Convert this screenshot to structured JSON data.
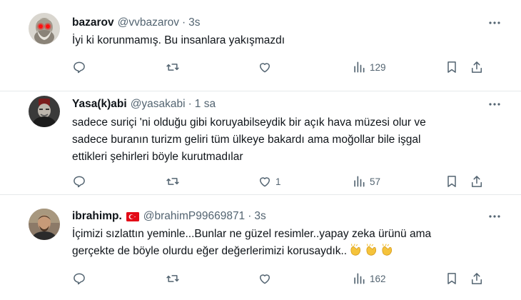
{
  "tweets": [
    {
      "name": "bazarov",
      "handle": "@vvbazarov",
      "sep": "·",
      "time": "3s",
      "lines": [
        "İyi ki korunmamış. Bu insanlara yakışmazdı"
      ],
      "replies": "",
      "retweets": "",
      "likes": "",
      "views": "129",
      "avatar_icon": "bearded-man-red-eyes-avatar"
    },
    {
      "name": "Yasa(k)abi",
      "handle": "@yasakabi",
      "sep": "·",
      "time": "1 sa",
      "lines": [
        "sadece suriçi 'ni olduğu gibi koruyabilseydik bir açık hava müzesi olur ve",
        "sadece buranın turizm geliri tüm ülkeye bakardı ama moğollar bile işgal",
        "ettikleri şehirleri böyle kurutmadılar"
      ],
      "replies": "",
      "retweets": "",
      "likes": "1",
      "views": "57",
      "avatar_icon": "dark-portrait-fez-avatar"
    },
    {
      "name": "ibrahimp.",
      "flag": "turkey-flag-icon",
      "handle": "@brahimP99669871",
      "sep": "·",
      "time": "3s",
      "lines": [
        "İçimizi sızlattın yeminle...Bunlar ne güzel resimler..yapay zeka ürünü ama",
        "gerçekte de böyle olurdu eğer değerlerimizi korusaydık.."
      ],
      "emoji": "clapping-hands",
      "emoji_count": 3,
      "replies": "",
      "retweets": "",
      "likes": "",
      "views": "162",
      "avatar_icon": "man-photo-avatar"
    }
  ],
  "icons": {
    "reply": "reply-icon",
    "retweet": "retweet-icon",
    "like": "like-icon",
    "views": "views-icon",
    "bookmark": "bookmark-icon",
    "share": "share-icon",
    "more": "more-icon"
  },
  "colors": {
    "text": "#0f1419",
    "secondary": "#536471",
    "divider": "#e6e9eb",
    "flag_red": "#e30a17",
    "emoji_yellow": "#f5c33b"
  }
}
